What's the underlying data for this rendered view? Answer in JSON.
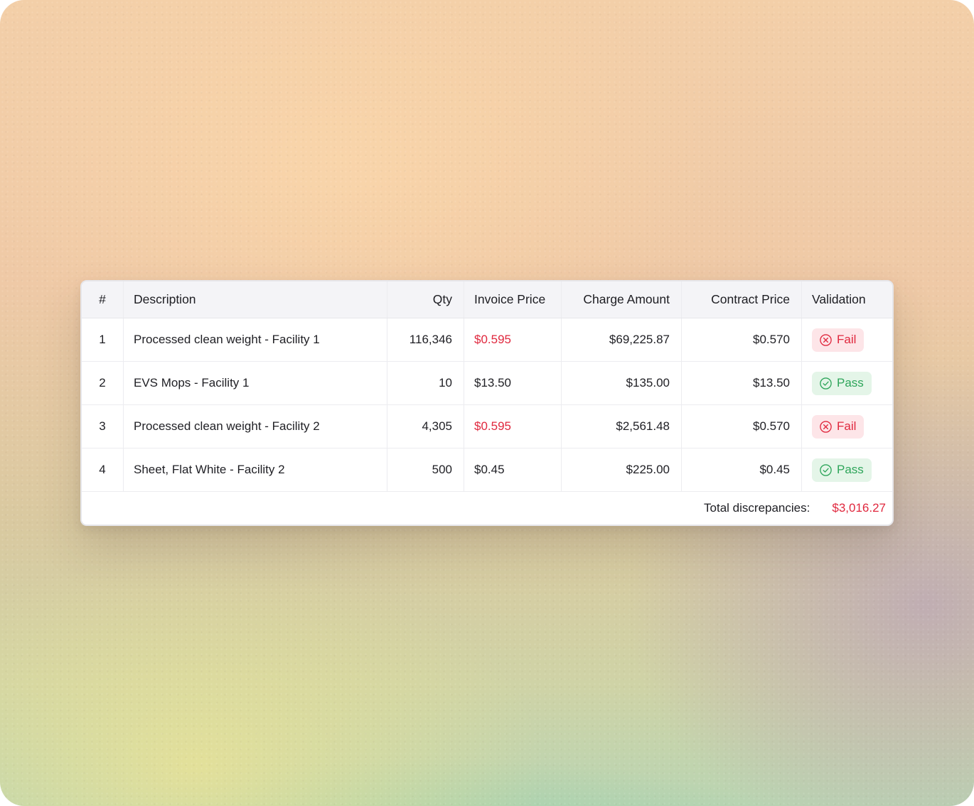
{
  "table": {
    "headers": {
      "num": "#",
      "description": "Description",
      "qty": "Qty",
      "invoice_price": "Invoice Price",
      "charge_amount": "Charge Amount",
      "contract_price": "Contract Price",
      "validation": "Validation"
    },
    "rows": [
      {
        "num": "1",
        "description": "Processed clean weight - Facility 1",
        "qty": "116,346",
        "invoice_price": "$0.595",
        "charge_amount": "$69,225.87",
        "contract_price": "$0.570",
        "validation": "Fail",
        "status": "fail"
      },
      {
        "num": "2",
        "description": "EVS Mops - Facility 1",
        "qty": "10",
        "invoice_price": "$13.50",
        "charge_amount": "$135.00",
        "contract_price": "$13.50",
        "validation": "Pass",
        "status": "pass"
      },
      {
        "num": "3",
        "description": "Processed clean weight - Facility 2",
        "qty": "4,305",
        "invoice_price": "$0.595",
        "charge_amount": "$2,561.48",
        "contract_price": "$0.570",
        "validation": "Fail",
        "status": "fail"
      },
      {
        "num": "4",
        "description": "Sheet, Flat White - Facility 2",
        "qty": "500",
        "invoice_price": "$0.45",
        "charge_amount": "$225.00",
        "contract_price": "$0.45",
        "validation": "Pass",
        "status": "pass"
      }
    ]
  },
  "footer": {
    "total_label": "Total discrepancies:",
    "total_value": "$3,016.27"
  },
  "colors": {
    "fail": "#e0283e",
    "pass": "#2ea55a"
  },
  "icons": {
    "fail": "x-circle-icon",
    "pass": "check-circle-icon"
  }
}
